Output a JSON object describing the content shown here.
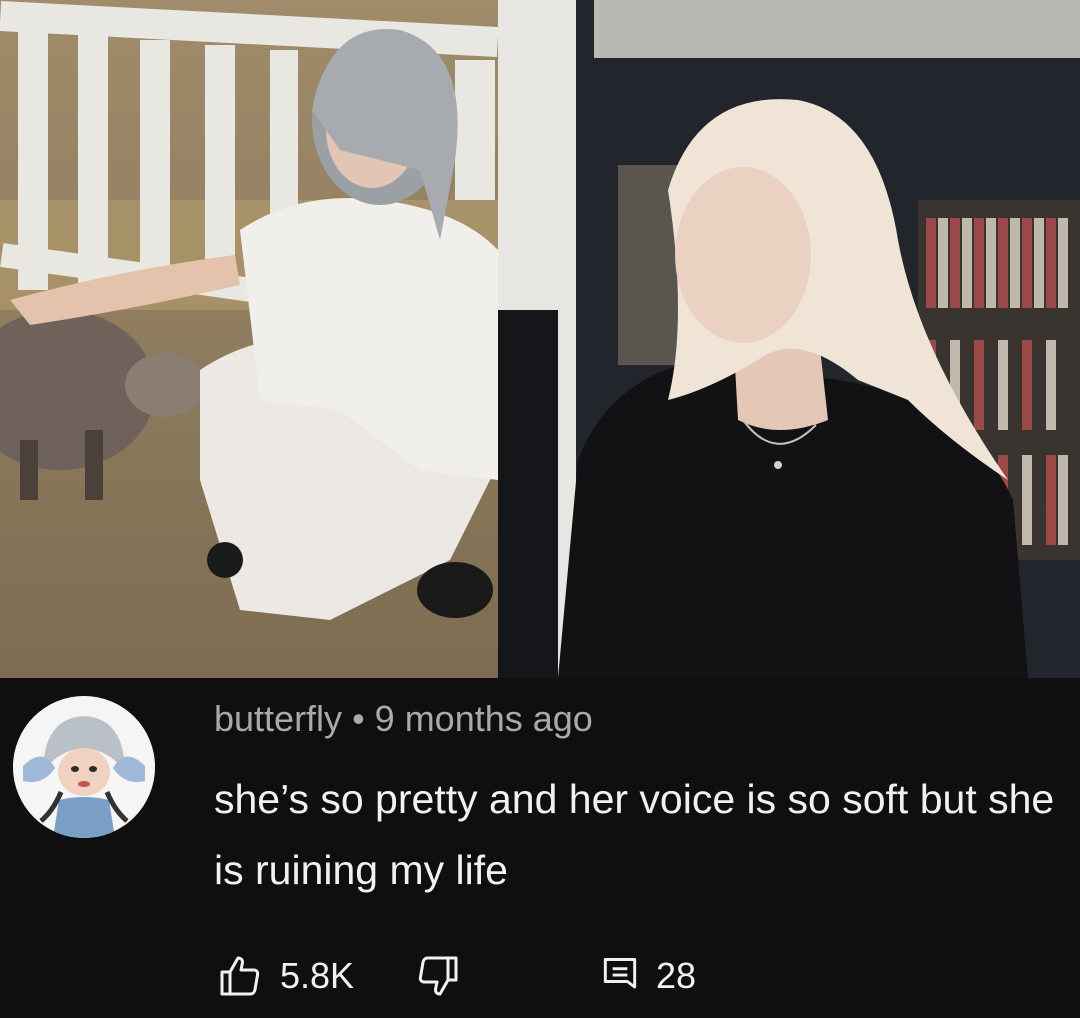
{
  "comment": {
    "author": "butterfly",
    "separator": "•",
    "time": "9 months ago",
    "text": "she’s so pretty and her voice is so soft but she is ruining my life",
    "likes": "5.8K",
    "replies": "28"
  },
  "icons": {
    "like": "thumbs-up-icon",
    "dislike": "thumbs-down-icon",
    "reply": "reply-icon"
  },
  "colors": {
    "background": "#0f0f0f",
    "text_primary": "#f1f1f1",
    "text_secondary": "#aaaaaa"
  }
}
